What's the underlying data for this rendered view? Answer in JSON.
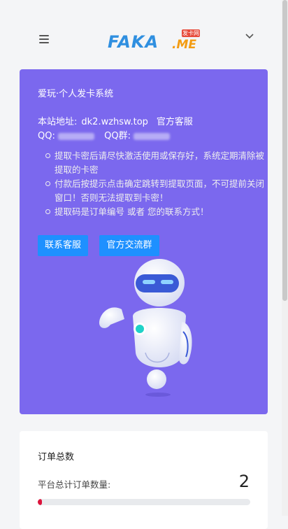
{
  "header": {
    "logo_text": "FAKA",
    "logo_suffix": ".ME",
    "logo_tag": "发卡网",
    "menu_icon": "hamburger-icon",
    "chevron_icon": "chevron-down-icon"
  },
  "hero": {
    "title": "爱玩·个人发卡系统",
    "site_label": "本站地址:",
    "site_url": "dk2.wzhsw.top",
    "service_link": "官方客服",
    "qq_label": "QQ:",
    "qq_group_label": "QQ群:",
    "notes": [
      "提取卡密后请尽快激活使用或保存好，系统定期清除被提取的卡密",
      "付款后按提示点击确定跳转到提取页面，不可提前关闭窗口！否则无法提取到卡密！",
      "提取码是订单编号 或者 您的联系方式！"
    ],
    "btn_contact": "联系客服",
    "btn_group": "官方交流群",
    "bg_color": "#7b68ee",
    "button_color": "#1e90ff"
  },
  "stats": {
    "title": "订单总数",
    "label": "平台总计订单数量:",
    "count": "2",
    "progress_fraction": 0.02,
    "progress_color": "#dc143c"
  }
}
